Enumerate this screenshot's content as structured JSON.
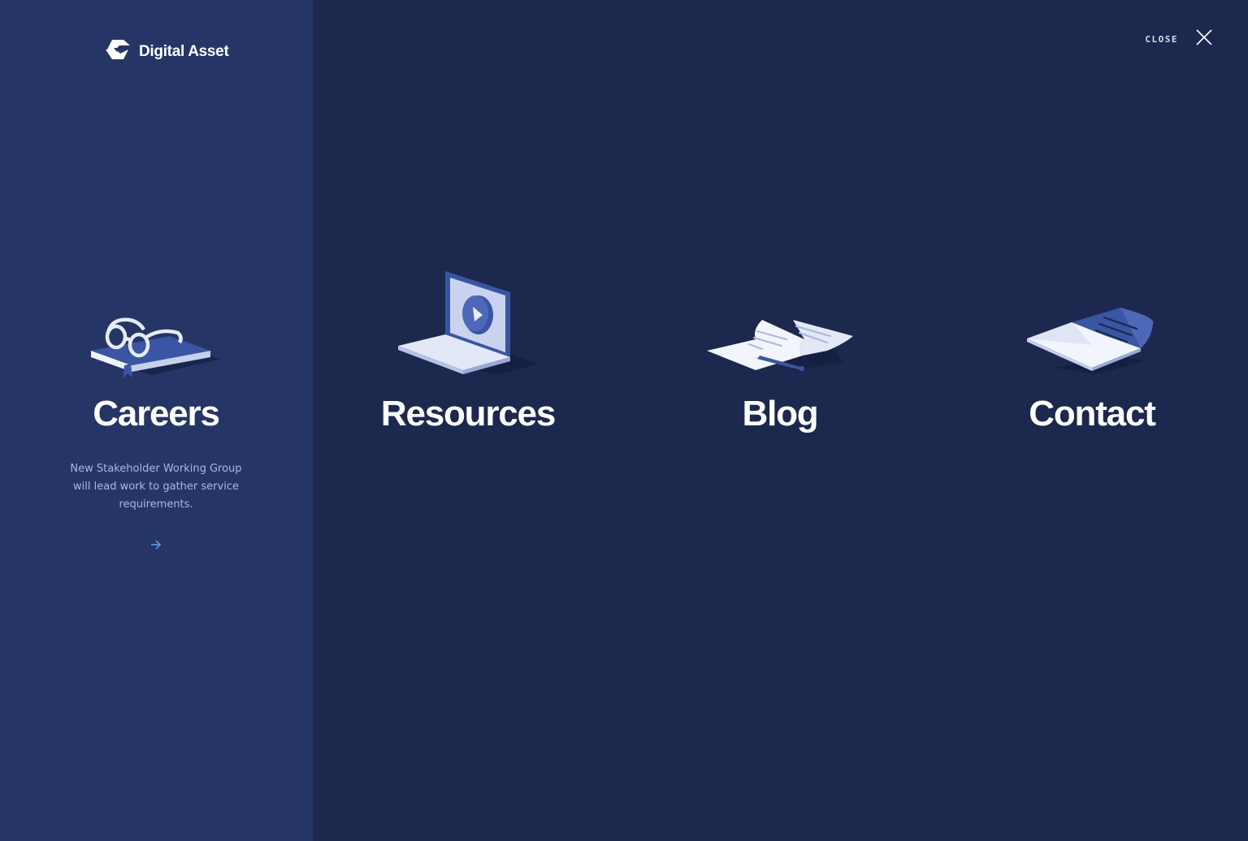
{
  "brand": {
    "name": "Digital Asset",
    "logo_icon": "digital-asset-logo-icon"
  },
  "header": {
    "close_label": "CLOSE",
    "close_icon": "close-icon"
  },
  "colors": {
    "background": "#1c284d",
    "active_panel": "#253566",
    "text": "#ffffff",
    "description": "#aab8e2",
    "accent": "#5b8fd9"
  },
  "menu": {
    "items": [
      {
        "label": "Careers",
        "icon": "book-glasses-icon",
        "active": true,
        "description": "New Stakeholder Working Group will lead work to gather service requirements.",
        "arrow_icon": "arrow-right-icon"
      },
      {
        "label": "Resources",
        "icon": "laptop-video-icon",
        "active": false
      },
      {
        "label": "Blog",
        "icon": "document-pen-icon",
        "active": false
      },
      {
        "label": "Contact",
        "icon": "envelope-letter-icon",
        "active": false
      }
    ]
  }
}
